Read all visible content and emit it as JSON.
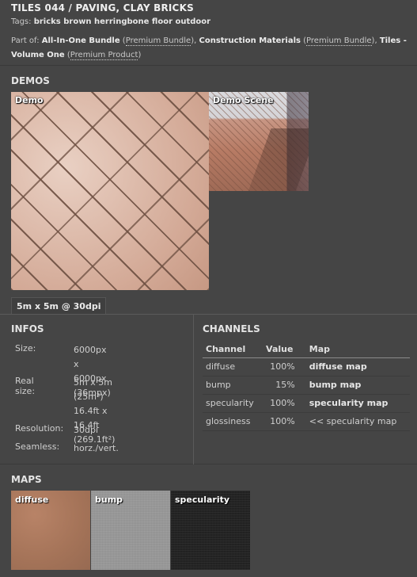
{
  "header": {
    "title": "TILES 044 / PAVING, CLAY BRICKS",
    "tags_label": "Tags:",
    "tags_value": "bricks brown herringbone floor outdoor",
    "partof_label": "Part of:",
    "bundles": [
      {
        "name": "All-In-One Bundle",
        "kind": "Premium Bundle"
      },
      {
        "name": "Construction Materials",
        "kind": "Premium Bundle"
      },
      {
        "name": "Tiles - Volume One",
        "kind": "Premium Product"
      }
    ]
  },
  "demos": {
    "heading": "DEMOS",
    "demo_label": "Demo",
    "scene_label": "Demo Scene",
    "size_tab": "5m x 5m @ 30dpi"
  },
  "infos": {
    "heading": "INFOS",
    "size_key": "Size:",
    "size_line1": "6000px x 6000px",
    "size_line2": "(36mpx)",
    "real_key": "Real size:",
    "real_line1": "5m x 5m (25m²)",
    "real_line2": "16.4ft x 16.4ft",
    "real_line3": "(269.1ft²)",
    "res_key": "Resolution:",
    "res_val": "30dpi",
    "seam_key": "Seamless:",
    "seam_val": "horz./vert."
  },
  "channels": {
    "heading": "CHANNELS",
    "columns": [
      "Channel",
      "Value",
      "Map"
    ],
    "rows": [
      {
        "channel": "diffuse",
        "value": "100%",
        "map": "diffuse map"
      },
      {
        "channel": "bump",
        "value": "15%",
        "map": "bump map"
      },
      {
        "channel": "specularity",
        "value": "100%",
        "map": "specularity map"
      },
      {
        "channel": "glossiness",
        "value": "100%",
        "map": "<< specularity map"
      }
    ]
  },
  "maps": {
    "heading": "MAPS",
    "items": [
      "diffuse",
      "bump",
      "specularity"
    ]
  },
  "colors": {
    "background": "#454545",
    "diffuse_swatch": "#a47358",
    "bump_swatch": "#9a9a9a",
    "specularity_swatch": "#1f1f1f"
  }
}
